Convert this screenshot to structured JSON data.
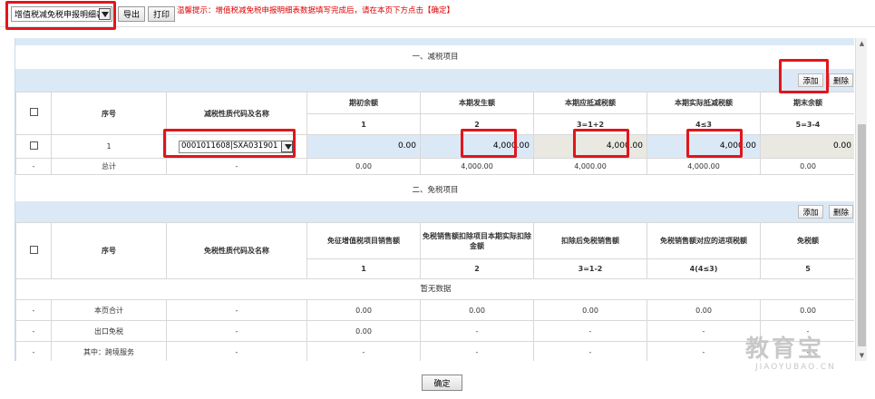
{
  "toolbar": {
    "report_select_value": "增值税减免税申报明细表",
    "export_label": "导出",
    "print_label": "打印",
    "hint": "温馨提示：增值税减免税申报明细表数据填写完成后，请在本页下方点击【确定】"
  },
  "section1": {
    "title": "一、减税项目",
    "add_label": "添加",
    "delete_label": "删除",
    "headers": [
      "序号",
      "减税性质代码及名称",
      "期初余额",
      "本期发生额",
      "本期应抵减税额",
      "本期实际抵减税额",
      "期末余额"
    ],
    "formula_row": [
      "1",
      "2",
      "3=1+2",
      "4≤3",
      "5=3-4"
    ],
    "row": {
      "index": "1",
      "code_value": "0001011608|SXA031901",
      "opening": "0.00",
      "current": "4,000.00",
      "should_deduct": "4,000.00",
      "actual_deduct": "4,000.00",
      "closing": "0.00"
    },
    "total_row": [
      "-",
      "总计",
      "-",
      "0.00",
      "4,000.00",
      "4,000.00",
      "4,000.00",
      "0.00"
    ]
  },
  "section2": {
    "title": "二、免税项目",
    "add_label": "添加",
    "delete_label": "删除",
    "headers": [
      "序号",
      "免税性质代码及名称",
      "免征增值税项目销售额",
      "免税销售额扣除项目本期实际扣除金额",
      "扣除后免税销售额",
      "免税销售额对应的进项税额",
      "免税额"
    ],
    "formula_row": [
      "1",
      "2",
      "3=1-2",
      "4(4≤3)",
      "5"
    ],
    "no_data": "暂无数据",
    "rows": [
      [
        "-",
        "本页合计",
        "-",
        "0.00",
        "0.00",
        "0.00",
        "0.00",
        "0.00"
      ],
      [
        "-",
        "出口免税",
        "-",
        "0.00",
        "-",
        "-",
        "-",
        "-"
      ],
      [
        "-",
        "其中：跨境服务",
        "-",
        "-",
        "-",
        "-",
        "-",
        "-"
      ]
    ]
  },
  "footer": {
    "confirm_label": "确定"
  },
  "watermark": {
    "main": "教育宝",
    "sub": "JIAOYUBAO.CN"
  }
}
